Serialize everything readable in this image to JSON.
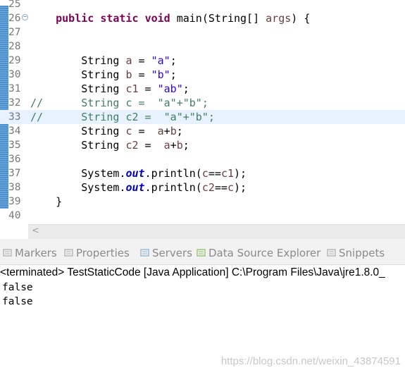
{
  "editor": {
    "lines": [
      {
        "num": "25",
        "segments": []
      },
      {
        "num": "26",
        "fold": true,
        "segments": [
          {
            "t": "    "
          },
          {
            "t": "public",
            "c": "kw"
          },
          {
            "t": " "
          },
          {
            "t": "static",
            "c": "kw"
          },
          {
            "t": " "
          },
          {
            "t": "void",
            "c": "kw"
          },
          {
            "t": " main(String[] "
          },
          {
            "t": "args",
            "c": "param"
          },
          {
            "t": ") {"
          }
        ]
      },
      {
        "num": "27",
        "segments": []
      },
      {
        "num": "28",
        "segments": []
      },
      {
        "num": "29",
        "segments": [
          {
            "t": "        String "
          },
          {
            "t": "a",
            "c": "param"
          },
          {
            "t": " = "
          },
          {
            "t": "\"a\"",
            "c": "str"
          },
          {
            "t": ";"
          }
        ]
      },
      {
        "num": "30",
        "segments": [
          {
            "t": "        String "
          },
          {
            "t": "b",
            "c": "param"
          },
          {
            "t": " = "
          },
          {
            "t": "\"b\"",
            "c": "str"
          },
          {
            "t": ";"
          }
        ]
      },
      {
        "num": "31",
        "segments": [
          {
            "t": "        String "
          },
          {
            "t": "c1",
            "c": "param"
          },
          {
            "t": " = "
          },
          {
            "t": "\"ab\"",
            "c": "str"
          },
          {
            "t": ";"
          }
        ]
      },
      {
        "num": "32",
        "segments": [
          {
            "t": "//      String c =  \"a\"+\"b\";",
            "c": "cmt"
          }
        ]
      },
      {
        "num": "33",
        "highlight": true,
        "segments": [
          {
            "t": "//      String c2 =  \"a\"+\"b\";",
            "c": "cmt"
          }
        ]
      },
      {
        "num": "34",
        "segments": [
          {
            "t": "        String "
          },
          {
            "t": "c",
            "c": "param"
          },
          {
            "t": " =  "
          },
          {
            "t": "a",
            "c": "param"
          },
          {
            "t": "+"
          },
          {
            "t": "b",
            "c": "param"
          },
          {
            "t": ";"
          }
        ]
      },
      {
        "num": "35",
        "segments": [
          {
            "t": "        String "
          },
          {
            "t": "c2",
            "c": "param"
          },
          {
            "t": " =  "
          },
          {
            "t": "a",
            "c": "param"
          },
          {
            "t": "+"
          },
          {
            "t": "b",
            "c": "param"
          },
          {
            "t": ";"
          }
        ]
      },
      {
        "num": "36",
        "segments": []
      },
      {
        "num": "37",
        "segments": [
          {
            "t": "        System."
          },
          {
            "t": "out",
            "c": "fld"
          },
          {
            "t": ".println("
          },
          {
            "t": "c",
            "c": "param"
          },
          {
            "t": "=="
          },
          {
            "t": "c1",
            "c": "param"
          },
          {
            "t": ");"
          }
        ]
      },
      {
        "num": "38",
        "segments": [
          {
            "t": "        System."
          },
          {
            "t": "out",
            "c": "fld"
          },
          {
            "t": ".println("
          },
          {
            "t": "c2",
            "c": "param"
          },
          {
            "t": "=="
          },
          {
            "t": "c",
            "c": "param"
          },
          {
            "t": ");"
          }
        ]
      },
      {
        "num": "39",
        "segments": [
          {
            "t": "    }"
          }
        ]
      },
      {
        "num": "40",
        "segments": []
      }
    ]
  },
  "scroll": {
    "left_arrow": "<"
  },
  "tabs": [
    {
      "label": "Markers",
      "icon": "markers-icon",
      "color": "#b0b0b0"
    },
    {
      "label": "Properties",
      "icon": "properties-icon",
      "color": "#b0b0b0"
    },
    {
      "label": "Servers",
      "icon": "servers-icon",
      "color": "#8fb0d0"
    },
    {
      "label": "Data Source Explorer",
      "icon": "data-source-icon",
      "color": "#8fbf6a"
    },
    {
      "label": "Snippets",
      "icon": "snippets-icon",
      "color": "#b0b0b0"
    }
  ],
  "console": {
    "header": "<terminated> TestStaticCode [Java Application] C:\\Program Files\\Java\\jre1.8.0_",
    "output": [
      "false",
      "false"
    ]
  },
  "watermark": "https://blog.csdn.net/weixin_43874591"
}
